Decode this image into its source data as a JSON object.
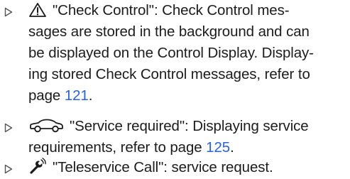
{
  "items": [
    {
      "lines": [
        {
          "pre": "\"Check Control\": Check Control mes-"
        },
        {
          "pre": "sages are stored in the background and can"
        },
        {
          "pre": "be displayed on the Control Display. Display-"
        },
        {
          "pre": "ing stored Check Control messages, refer to"
        },
        {
          "pre": "page ",
          "ref": "121",
          "post": "."
        }
      ],
      "icon": "warning-triangle-icon"
    },
    {
      "lines": [
        {
          "pre": "\"Service required\": Displaying service"
        },
        {
          "pre": "requirements, refer to page ",
          "ref": "125",
          "post": "."
        }
      ],
      "icon": "car-service-icon"
    },
    {
      "lines": [
        {
          "pre": "\"Teleservice Call\": service request."
        }
      ],
      "icon": "wrench-signal-icon"
    }
  ],
  "colors": {
    "text": "#1c1c1c",
    "link": "#2b63d6",
    "bullet": "#555555"
  }
}
